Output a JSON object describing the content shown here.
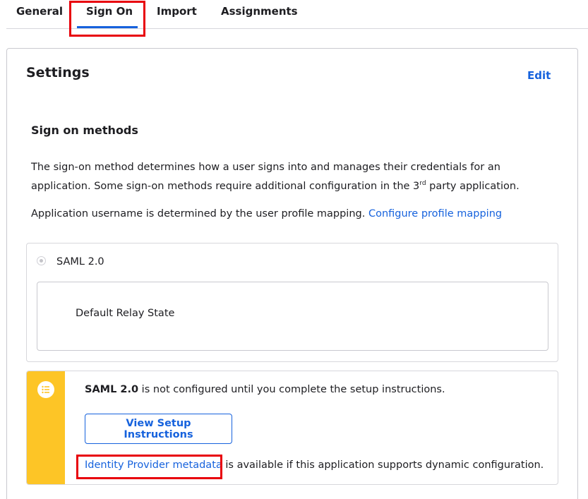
{
  "tabs": [
    {
      "label": "General"
    },
    {
      "label": "Sign On"
    },
    {
      "label": "Import"
    },
    {
      "label": "Assignments"
    }
  ],
  "settings": {
    "title": "Settings",
    "edit_label": "Edit"
  },
  "sign_on": {
    "section_title": "Sign on methods",
    "description_part1": "The sign-on method determines how a user signs into and manages their credentials for an application. Some sign-on methods require additional configuration in the 3",
    "description_sup": "rd",
    "description_part2": " party application.",
    "mapping_text": "Application username is determined by the user profile mapping. ",
    "mapping_link": "Configure profile mapping"
  },
  "saml": {
    "method_label": "SAML 2.0",
    "relay_state_label": "Default Relay State"
  },
  "callout": {
    "method_name": "SAML 2.0",
    "message": " is not configured until you complete the setup instructions.",
    "button_label": "View Setup Instructions",
    "metadata_link": "Identity Provider metadata",
    "metadata_text": " is available if this application supports dynamic configuration."
  },
  "colors": {
    "accent": "#1662dd",
    "warning": "#fdc526",
    "highlight": "#e8000b"
  }
}
